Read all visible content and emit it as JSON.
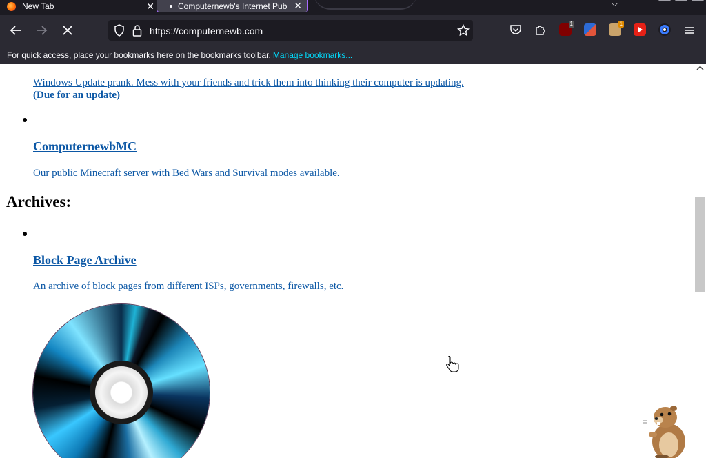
{
  "browser": {
    "tabs": [
      {
        "title": "New Tab",
        "active": false
      },
      {
        "title": "Computernewb's Internet Pub",
        "active": true
      }
    ],
    "url": "https://computernewb.com",
    "bookmarks_bar": {
      "message": "For quick access, place your bookmarks here on the bookmarks toolbar.",
      "link": "Manage bookmarks..."
    },
    "extension_badges": {
      "ublock": "1",
      "other": "1"
    }
  },
  "page": {
    "windows_update": {
      "description": "Windows Update prank. Mess with your friends and trick them into thinking their computer is updating.",
      "extra": "(Due for an update)"
    },
    "minecraft": {
      "title": "ComputernewbMC",
      "description": "Our public Minecraft server with Bed Wars and Survival modes available."
    },
    "archives_heading": "Archives:",
    "block_page_archive": {
      "title": "Block Page Archive",
      "description": "An archive of block pages from different ISPs, governments, firewalls, etc."
    }
  },
  "colors": {
    "link": "#0b57a5",
    "chrome_dark": "#2b2a33",
    "tabbar": "#1c1b22",
    "bookmark_link": "#00ddff"
  }
}
